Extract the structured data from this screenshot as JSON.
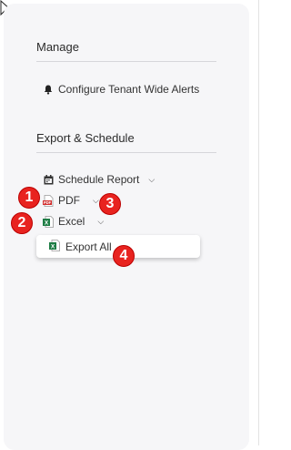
{
  "manage": {
    "heading": "Manage",
    "configure_alerts": "Configure Tenant Wide Alerts"
  },
  "export": {
    "heading": "Export & Schedule",
    "schedule_report": "Schedule Report",
    "pdf": "PDF",
    "excel": "Excel",
    "export_all": "Export All"
  },
  "annotations": [
    "1",
    "2",
    "3",
    "4"
  ],
  "colors": {
    "panel_bg": "#f6f6f8",
    "badge_red": "#e8231f",
    "pdf_red": "#d32f2f",
    "excel_green": "#1e7d45"
  },
  "icons": {
    "cursor": "mouse-pointer-icon",
    "bell": "bell-icon",
    "calendar": "calendar-icon",
    "pdf": "pdf-file-icon",
    "excel": "excel-file-icon",
    "chevron": "chevron-down-icon"
  }
}
